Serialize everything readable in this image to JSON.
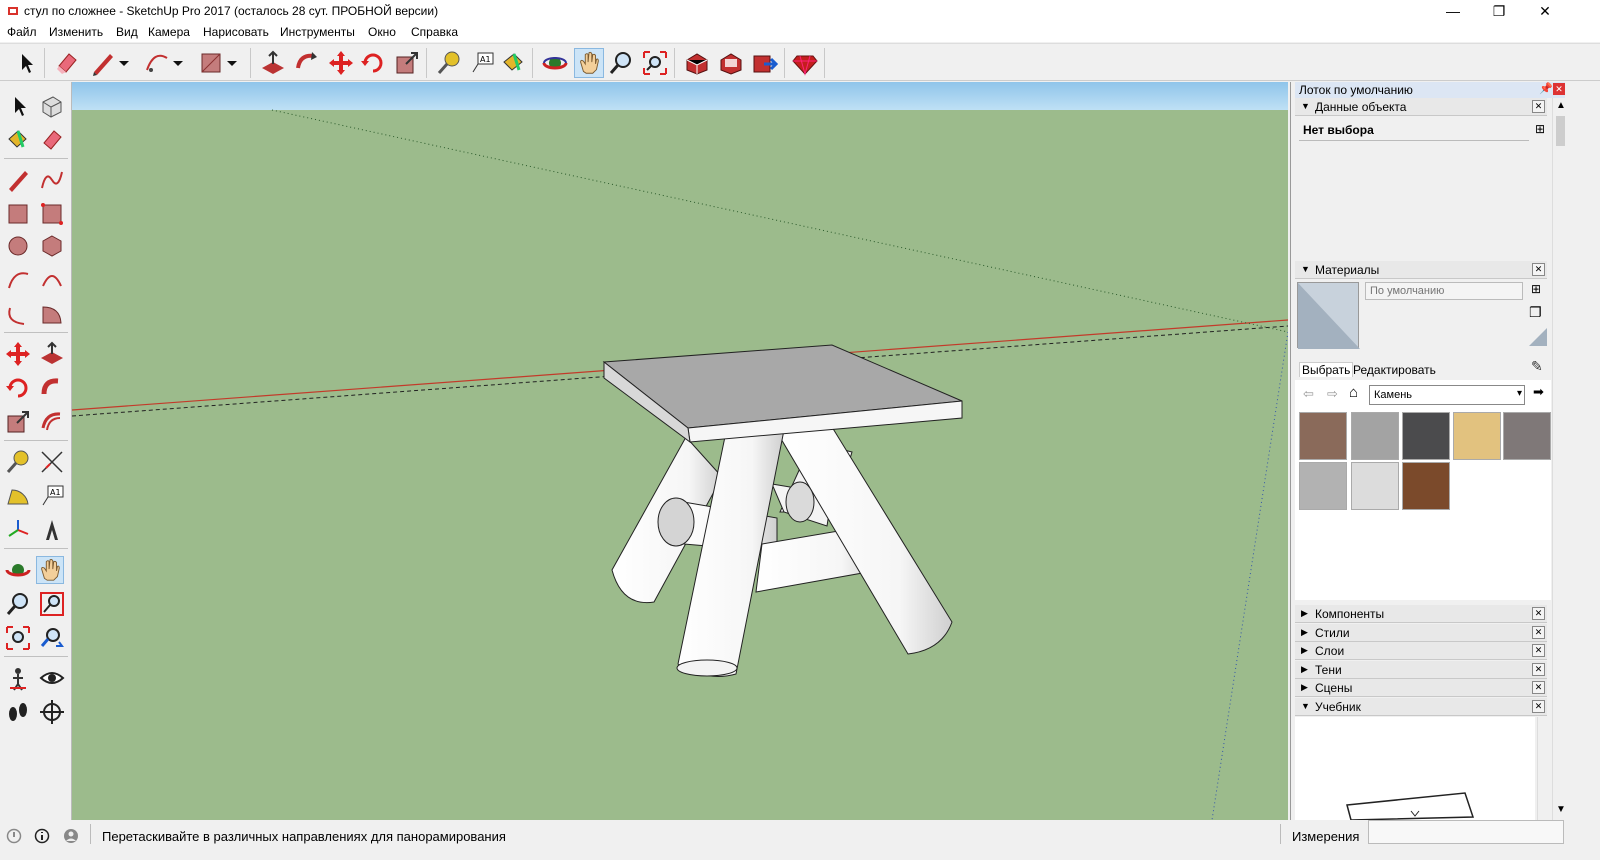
{
  "window": {
    "title": "стул по сложнее - SketchUp Pro 2017 (осталось 28 сут. ПРОБНОЙ версии)",
    "min_glyph": "—",
    "restore_glyph": "❐",
    "close_glyph": "✕"
  },
  "menu": {
    "items": [
      "Файл",
      "Изменить",
      "Вид",
      "Камера",
      "Нарисовать",
      "Инструменты",
      "Окно",
      "Справка"
    ]
  },
  "tray": {
    "title": "Лоток по умолчанию",
    "entity_info": {
      "label": "Данные объекта",
      "selection": "Нет выбора"
    },
    "materials": {
      "label": "Материалы",
      "name_placeholder": "По умолчанию",
      "tabs": [
        "Выбрать",
        "Редактировать"
      ],
      "library": "Камень",
      "swatch_colors": [
        "#8a6a5a",
        "#a3a3a3",
        "#4b4b4d",
        "#e2c27f",
        "#7f7878",
        "#b2b2b2",
        "#dcdcdc",
        "#7b4a2b"
      ]
    },
    "collapsed_panels": [
      "Компоненты",
      "Стили",
      "Слои",
      "Тени",
      "Сцены"
    ],
    "instructor": {
      "label": "Учебник"
    }
  },
  "status": {
    "hint": "Перетаскивайте в различных направлениях для панорамирования",
    "measure_label": "Измерения"
  },
  "colors": {
    "sky": "#a8d3f0",
    "ground": "#9cbb8c",
    "active_tool": "#cce4f7"
  }
}
